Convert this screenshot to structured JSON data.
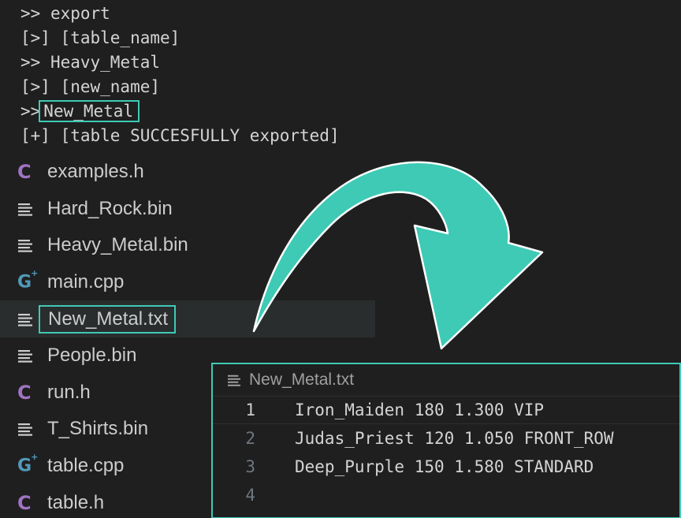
{
  "terminal": {
    "lines": [
      {
        "prefix": ">> ",
        "text": "export"
      },
      {
        "prefix": "[>] ",
        "text": "[table_name]"
      },
      {
        "prefix": ">> ",
        "text": "Heavy_Metal"
      },
      {
        "prefix": "[>] ",
        "text": "[new_name]"
      },
      {
        "prefix": ">> ",
        "text": "New_Metal"
      },
      {
        "prefix": "[+] ",
        "text": "[table SUCCESFULLY exported]"
      }
    ]
  },
  "explorer": {
    "files": [
      {
        "name": "examples.h",
        "icon": "c-header-icon"
      },
      {
        "name": "Hard_Rock.bin",
        "icon": "text-lines-icon"
      },
      {
        "name": "Heavy_Metal.bin",
        "icon": "text-lines-icon"
      },
      {
        "name": "main.cpp",
        "icon": "cpp-icon"
      },
      {
        "name": "New_Metal.txt",
        "icon": "text-lines-icon",
        "selected": true
      },
      {
        "name": "People.bin",
        "icon": "text-lines-icon"
      },
      {
        "name": "run.h",
        "icon": "c-header-icon"
      },
      {
        "name": "T_Shirts.bin",
        "icon": "text-lines-icon"
      },
      {
        "name": "table.cpp",
        "icon": "cpp-icon"
      },
      {
        "name": "table.h",
        "icon": "c-header-icon"
      }
    ]
  },
  "editor": {
    "tab_title": "New_Metal.txt",
    "lines": [
      {
        "num": "1",
        "text": "Iron_Maiden 180 1.300 VIP"
      },
      {
        "num": "2",
        "text": "Judas_Priest 120 1.050 FRONT_ROW"
      },
      {
        "num": "3",
        "text": "Deep_Purple 150 1.580 STANDARD"
      },
      {
        "num": "4",
        "text": ""
      }
    ]
  },
  "colors": {
    "accent": "#3ecab5",
    "c_icon": "#a074c4",
    "cpp_icon": "#519aba",
    "background": "#1f1f1f"
  }
}
